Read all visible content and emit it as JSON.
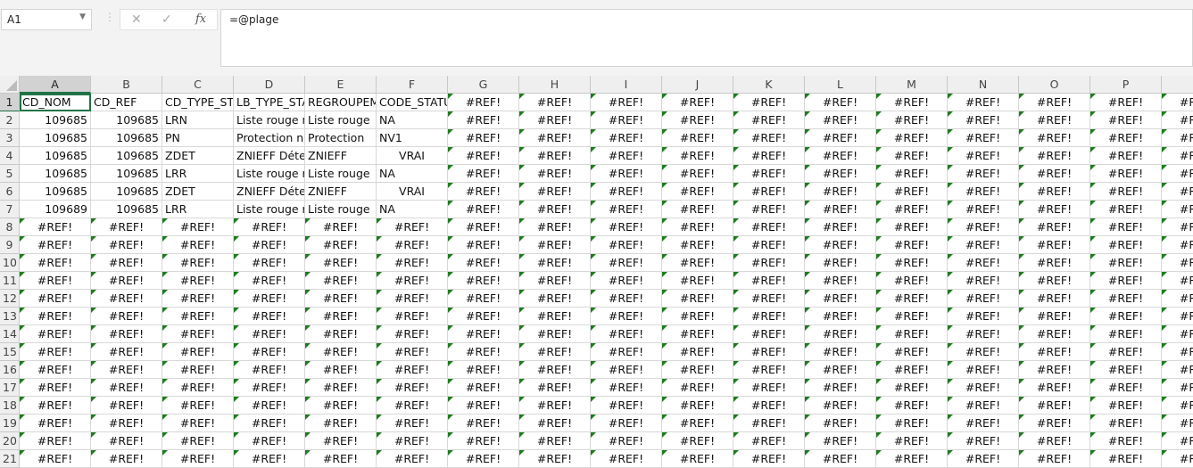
{
  "name_box": "A1",
  "formula": "=@plage",
  "colors": {
    "accent": "#217346",
    "error_marker": "#1e7b1e"
  },
  "icons": {
    "cancel": "close-icon",
    "enter": "check-icon",
    "function": "fx-icon"
  },
  "columns": [
    "A",
    "B",
    "C",
    "D",
    "E",
    "F",
    "G",
    "H",
    "I",
    "J",
    "K",
    "L",
    "M",
    "N",
    "O",
    "P",
    ""
  ],
  "row_numbers": [
    "1",
    "2",
    "3",
    "4",
    "5",
    "6",
    "7",
    "8",
    "9",
    "10",
    "11",
    "12",
    "13",
    "14",
    "15",
    "16",
    "17",
    "18",
    "19",
    "20",
    "21"
  ],
  "rows": [
    [
      "CD_NOM",
      "CD_REF",
      "CD_TYPE_STATUT",
      "LB_TYPE_STATUT",
      "REGROUPEMENT",
      "CODE_STATUT"
    ],
    [
      "109685",
      "109685",
      "LRN",
      "Liste rouge nationale",
      "Liste rouge",
      "NA"
    ],
    [
      "109685",
      "109685",
      "PN",
      "Protection nationale",
      "Protection",
      "NV1"
    ],
    [
      "109685",
      "109685",
      "ZDET",
      "ZNIEFF Déterminantes",
      "ZNIEFF",
      "VRAI"
    ],
    [
      "109685",
      "109685",
      "LRR",
      "Liste rouge régionale",
      "Liste rouge",
      "NA"
    ],
    [
      "109685",
      "109685",
      "ZDET",
      "ZNIEFF Déterminantes",
      "ZNIEFF",
      "VRAI"
    ],
    [
      "109689",
      "109685",
      "LRR",
      "Liste rouge régionale",
      "Liste rouge",
      "NA"
    ]
  ],
  "fill_value": "#REF!"
}
